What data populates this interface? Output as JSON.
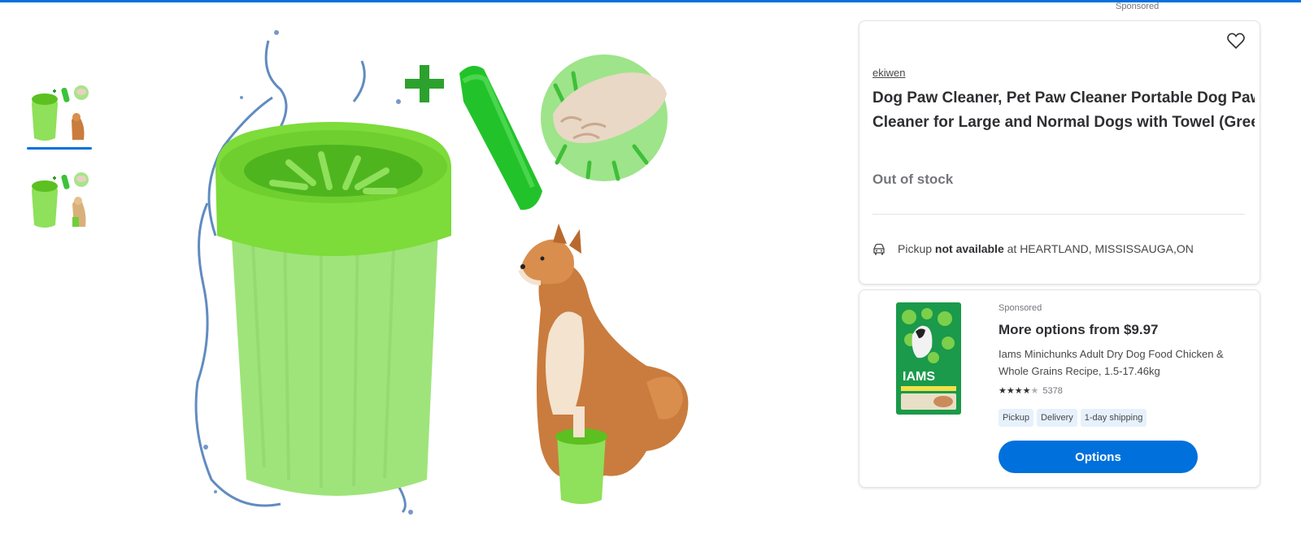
{
  "header": {
    "sponsored_label": "Sponsored"
  },
  "gallery": {
    "thumbnails": [
      {
        "icon": "paw-cleaner-cup-with-dog-thumbnail",
        "selected": true
      },
      {
        "icon": "paw-cleaner-cup-with-golden-dog-thumbnail",
        "selected": false
      }
    ],
    "hero_icon": "paw-cleaner-cup-towel-shiba-image"
  },
  "product": {
    "brand": "ekiwen",
    "title_line1": "Dog Paw Cleaner, Pet Paw Cleaner Portable Dog Paw",
    "title_line2": "Cleaner for Large and Normal Dogs with Towel (Gree",
    "stock_status": "Out of stock",
    "pickup_prefix": "Pickup",
    "pickup_status": "not available",
    "pickup_suffix": "at HEARTLAND, MISSISSAUGA,ON",
    "favorite_icon": "heart-icon",
    "pickup_icon": "car-icon"
  },
  "ad": {
    "sponsored_label": "Sponsored",
    "title": "More options from $9.97",
    "desc_line1": "Iams Minichunks Adult Dry Dog Food Chicken &",
    "desc_line2": "Whole Grains Recipe, 1.5-17.46kg",
    "rating": 4.5,
    "review_count": "5378",
    "chips": [
      "Pickup",
      "Delivery",
      "1-day shipping"
    ],
    "button_label": "Options",
    "product_icon": "iams-dog-food-bag-image"
  },
  "colors": {
    "accent": "#0071dc",
    "green": "#7ddb3a",
    "text": "#2e2f32"
  }
}
